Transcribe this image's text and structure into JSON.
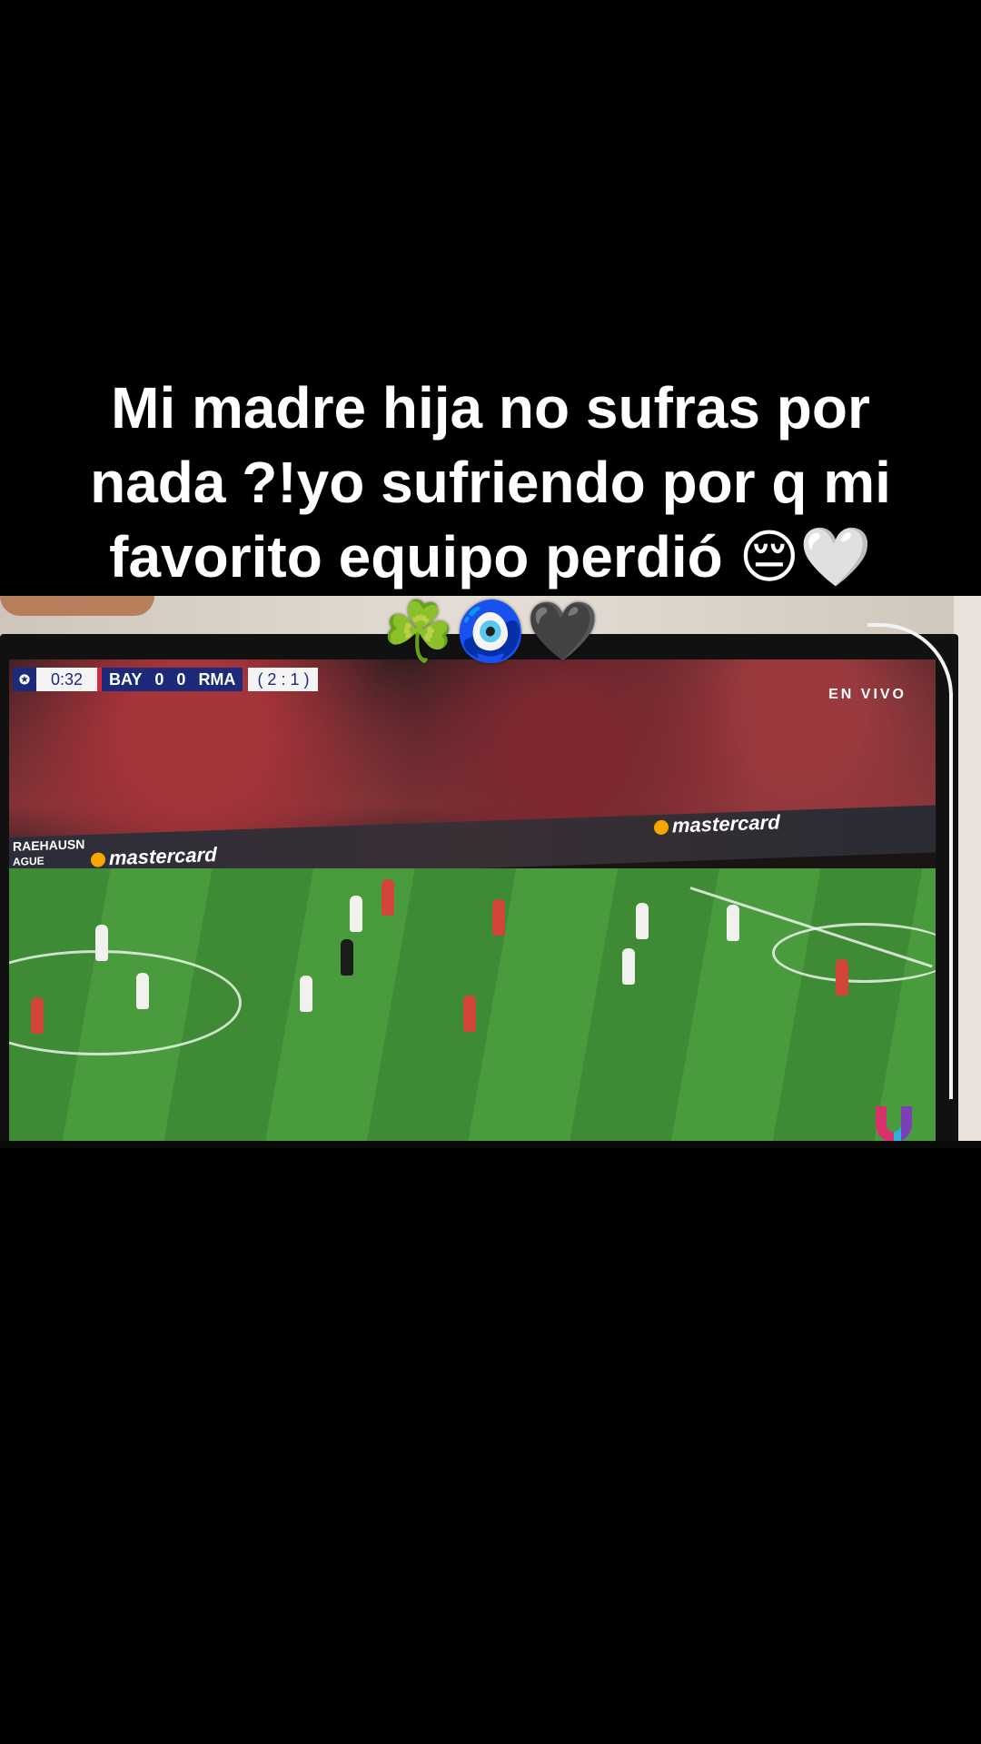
{
  "caption": {
    "line1": "Mi madre hija no sufras por",
    "line2": "nada ?!yo sufriendo por q mi",
    "line3": "favorito equipo perdió 😔🤍",
    "line4": "☘️🧿🖤"
  },
  "broadcast": {
    "clock": "0:32",
    "home_team": "BAY",
    "home_score": "0",
    "away_score": "0",
    "away_team": "RMA",
    "aggregate": "( 2 : 1 )",
    "live_label": "EN VIVO",
    "sponsor_1": "mastercard",
    "sponsor_2": "mastercard",
    "board_text": "RAEHAUSN",
    "board_text_2": "AGUE"
  },
  "colors": {
    "scorebug_blue": "#1d2a7a",
    "scorebug_red": "#d8283a",
    "pitch_green": "#4a9a3e"
  },
  "icons": [
    "champions-league-icon",
    "univision-logo-icon"
  ]
}
